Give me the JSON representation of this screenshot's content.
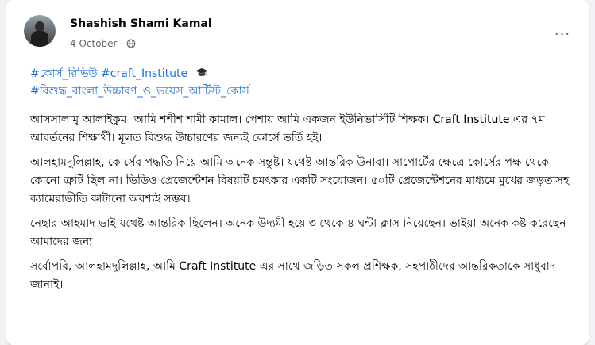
{
  "post": {
    "author": "Shashish Shami Kamal",
    "date": "4 October",
    "separator": "·",
    "more_label": "···",
    "privacy_icon": "globe-icon",
    "hashtags": {
      "tag1": "#কোর্স_রিভিউ",
      "tag2": "#craft_Institute",
      "tag3": "#বিশুদ্ধ_বাংলা_উচ্চারণ_ও_ভয়েস_আর্টিস্ট_কোর্স",
      "emoji": "graduation-cap-icon"
    },
    "paragraphs": [
      "আসসালামু আলাইকুম। আমি শশীশ শামী কামাল। পেশায় আমি একজন ইউনিভার্সিটি শিক্ষক। Craft Institute এর ৭ম আবর্তনের শিক্ষার্থী। মূলত বিশুদ্ধ উচ্চারণের জন্যই কোর্সে ভর্তি হই।",
      "আলহামদুলিল্লাহ, কোর্সের পদ্ধতি নিয়ে আমি অনেক সন্তুষ্ট। যথেষ্ট আন্তরিক উনারা। সাপোর্টের ক্ষেত্রে কোর্সের পক্ষ থেকে কোনো ত্রুটি ছিল না। ভিডিও প্রেজেন্টেশন বিষয়টি চমৎকার একটি সংযোজন। ৫০টি প্রেজেন্টেশনের মাধ্যমে মুখের জড়তাসহ ক্যামেরাভীতি কাটানো অবশ্যই সম্ভব।",
      "নেছার আহমাদ ভাই যথেষ্ট আন্তরিক ছিলেন। অনেক উদ্যমী হয়ে ৩ থেকে ৪ ঘন্টা ক্লাস নিয়েছেন। ভাইয়া অনেক কষ্ট করেছেন আমাদের জন্য।",
      "সর্বোপরি, আলহামদুলিল্লাহ, আমি Craft Institute এর সাথে জড়িত সকল প্রশিক্ষক, সহপাঠীদের আন্তরিকতাকে সাধুবাদ জানাই।"
    ]
  }
}
